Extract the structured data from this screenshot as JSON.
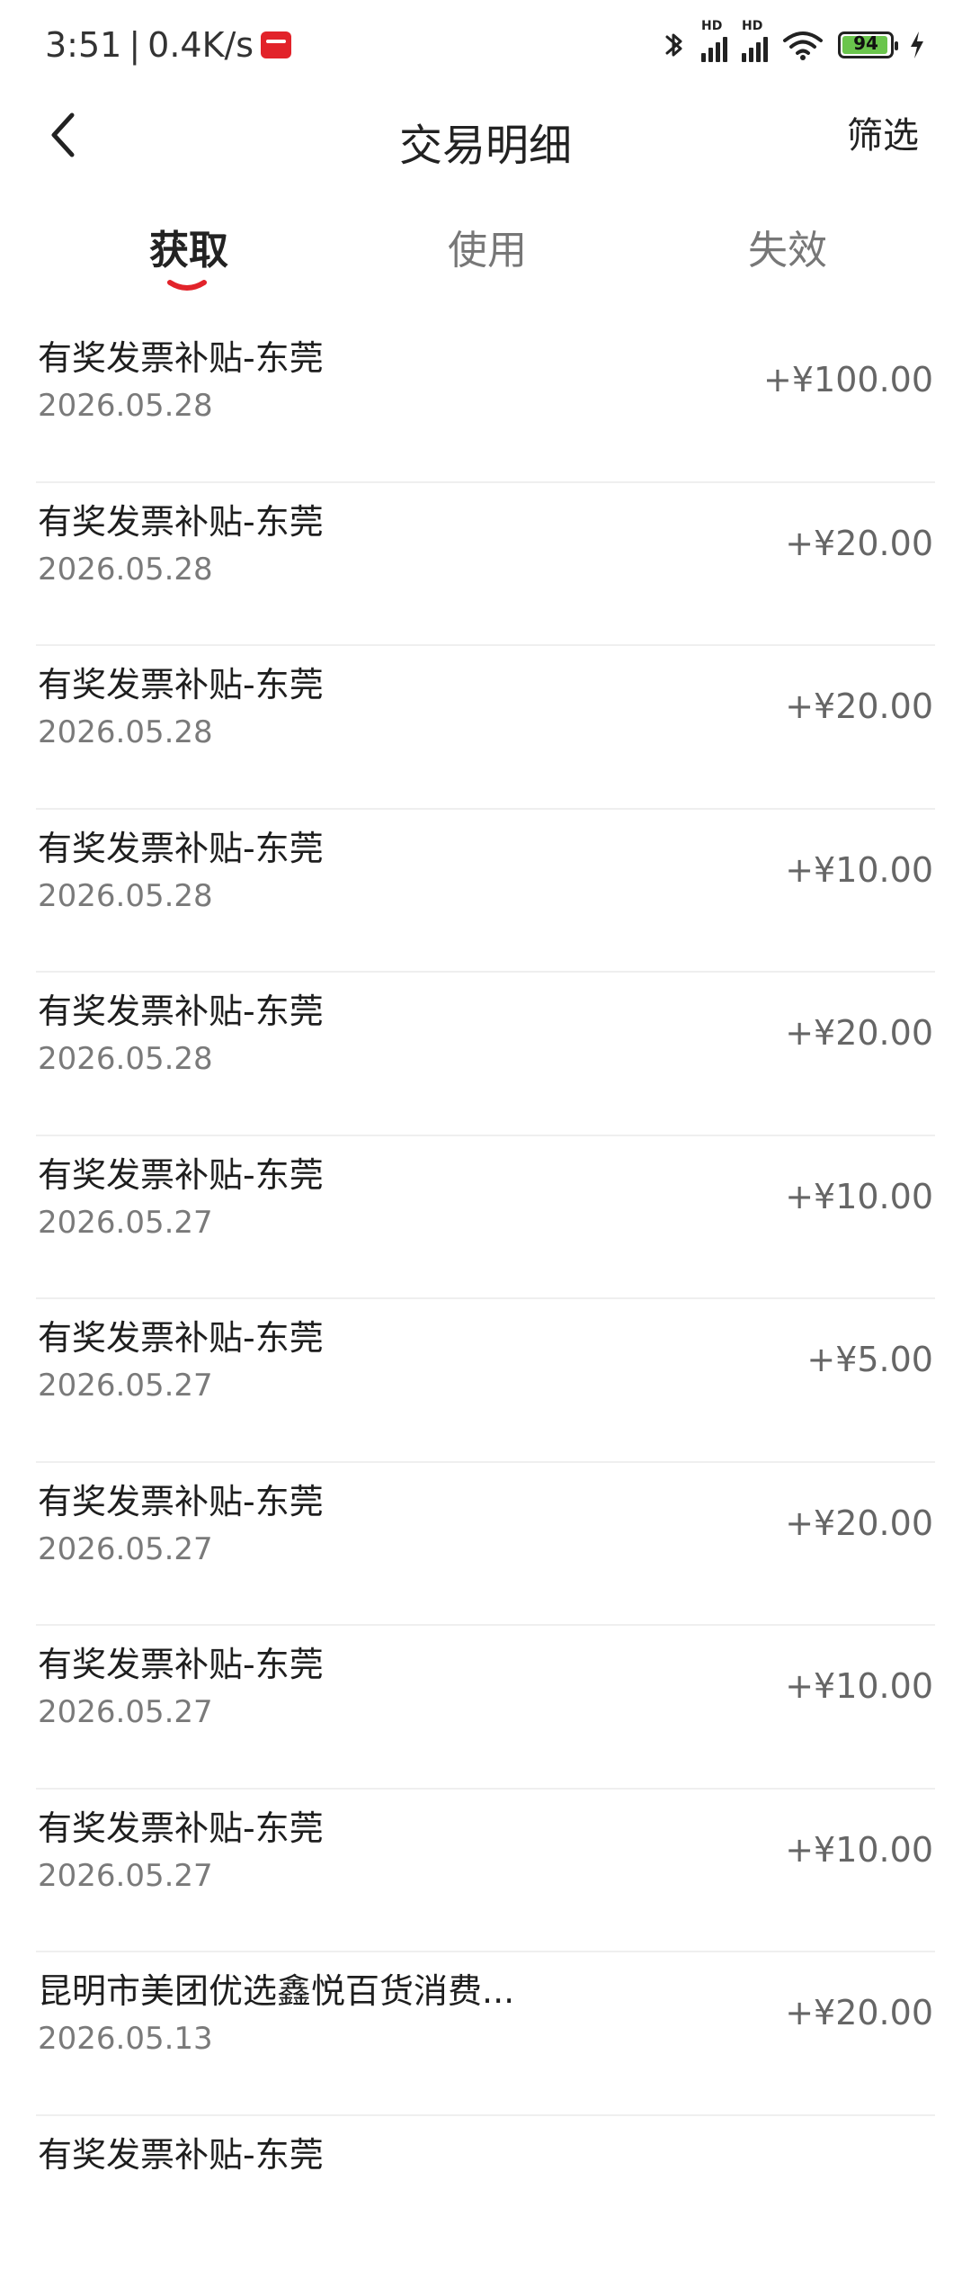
{
  "status_bar": {
    "time": "3:51",
    "separator": "|",
    "speed": "0.4K/s",
    "battery": "94",
    "network_label_1": "HD",
    "network_label_2": "HD"
  },
  "header": {
    "title": "交易明细",
    "filter_label": "筛选"
  },
  "tabs": [
    {
      "label": "获取",
      "active": true
    },
    {
      "label": "使用",
      "active": false
    },
    {
      "label": "失效",
      "active": false
    }
  ],
  "transactions": [
    {
      "title": "有奖发票补贴-东莞",
      "date": "2026.05.28",
      "amount": "+¥100.00"
    },
    {
      "title": "有奖发票补贴-东莞",
      "date": "2026.05.28",
      "amount": "+¥20.00"
    },
    {
      "title": "有奖发票补贴-东莞",
      "date": "2026.05.28",
      "amount": "+¥20.00"
    },
    {
      "title": "有奖发票补贴-东莞",
      "date": "2026.05.28",
      "amount": "+¥10.00"
    },
    {
      "title": "有奖发票补贴-东莞",
      "date": "2026.05.28",
      "amount": "+¥20.00"
    },
    {
      "title": "有奖发票补贴-东莞",
      "date": "2026.05.27",
      "amount": "+¥10.00"
    },
    {
      "title": "有奖发票补贴-东莞",
      "date": "2026.05.27",
      "amount": "+¥5.00"
    },
    {
      "title": "有奖发票补贴-东莞",
      "date": "2026.05.27",
      "amount": "+¥20.00"
    },
    {
      "title": "有奖发票补贴-东莞",
      "date": "2026.05.27",
      "amount": "+¥10.00"
    },
    {
      "title": "有奖发票补贴-东莞",
      "date": "2026.05.27",
      "amount": "+¥10.00"
    },
    {
      "title": "昆明市美团优选鑫悦百货消费...",
      "date": "2026.05.13",
      "amount": "+¥20.00"
    },
    {
      "title": "有奖发票补贴-东莞",
      "date": "",
      "amount": ""
    }
  ],
  "colors": {
    "accent": "#e2232a",
    "battery_fill": "#6ac54c",
    "divider": "#efefef"
  },
  "icons": {
    "back": "chevron-left-icon",
    "bluetooth": "bluetooth-icon",
    "signal": "signal-icon",
    "wifi": "wifi-icon",
    "battery": "battery-icon",
    "charging": "lightning-icon",
    "app": "app-notification-icon"
  }
}
